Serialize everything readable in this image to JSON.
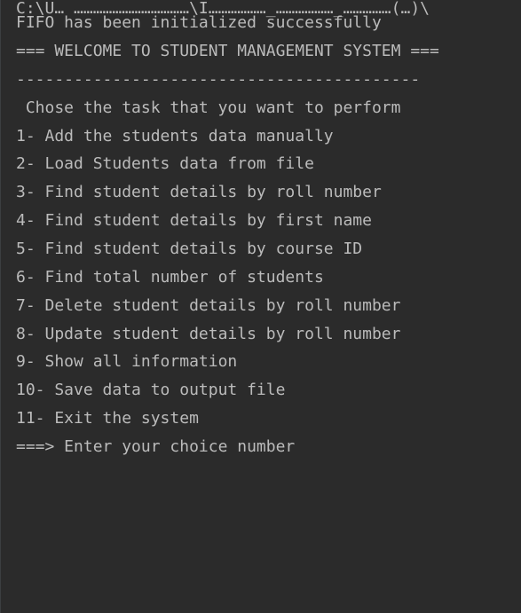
{
  "console": {
    "cut_line": "C:\\U… ………………………………\\I………………_………………_……………(…)\\",
    "lines": [
      "FIFO has been initialized successfully",
      "=== WELCOME TO STUDENT MANAGEMENT SYSTEM ===",
      "------------------------------------------",
      " Chose the task that you want to perform",
      "1- Add the students data manually",
      "2- Load Students data from file",
      "3- Find student details by roll number",
      "4- Find student details by first name",
      "5- Find student details by course ID",
      "6- Find total number of students",
      "7- Delete student details by roll number",
      "8- Update student details by roll number",
      "9- Show all information",
      "10- Save data to output file",
      "11- Exit the system",
      "===> Enter your choice number"
    ]
  }
}
